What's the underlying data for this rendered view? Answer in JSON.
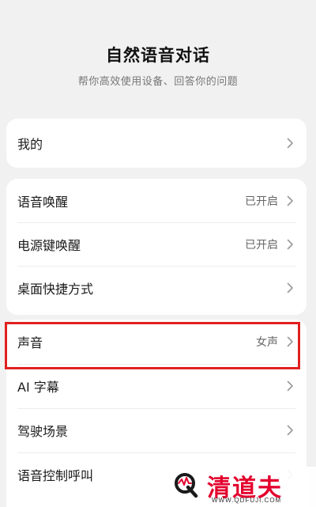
{
  "header": {
    "title": "自然语音对话",
    "subtitle": "帮你高效使用设备、回答你的问题"
  },
  "groups": [
    {
      "items": [
        {
          "label": "我的",
          "value": ""
        }
      ]
    },
    {
      "items": [
        {
          "label": "语音唤醒",
          "value": "已开启"
        },
        {
          "label": "电源键唤醒",
          "value": "已开启"
        },
        {
          "label": "桌面快捷方式",
          "value": ""
        }
      ]
    },
    {
      "items": [
        {
          "label": "声音",
          "value": "女声"
        },
        {
          "label": "AI 字幕",
          "value": ""
        },
        {
          "label": "驾驶场景",
          "value": ""
        },
        {
          "label": "语音控制呼叫",
          "value": ""
        }
      ]
    }
  ],
  "icons": {
    "chevron": "chevron-right-icon"
  },
  "highlight": {
    "color": "#e02020",
    "target": "声音"
  },
  "watermark": {
    "brand": "清道夫",
    "url": "WWW.QDFUJI.COM",
    "color": "#e3002d"
  }
}
